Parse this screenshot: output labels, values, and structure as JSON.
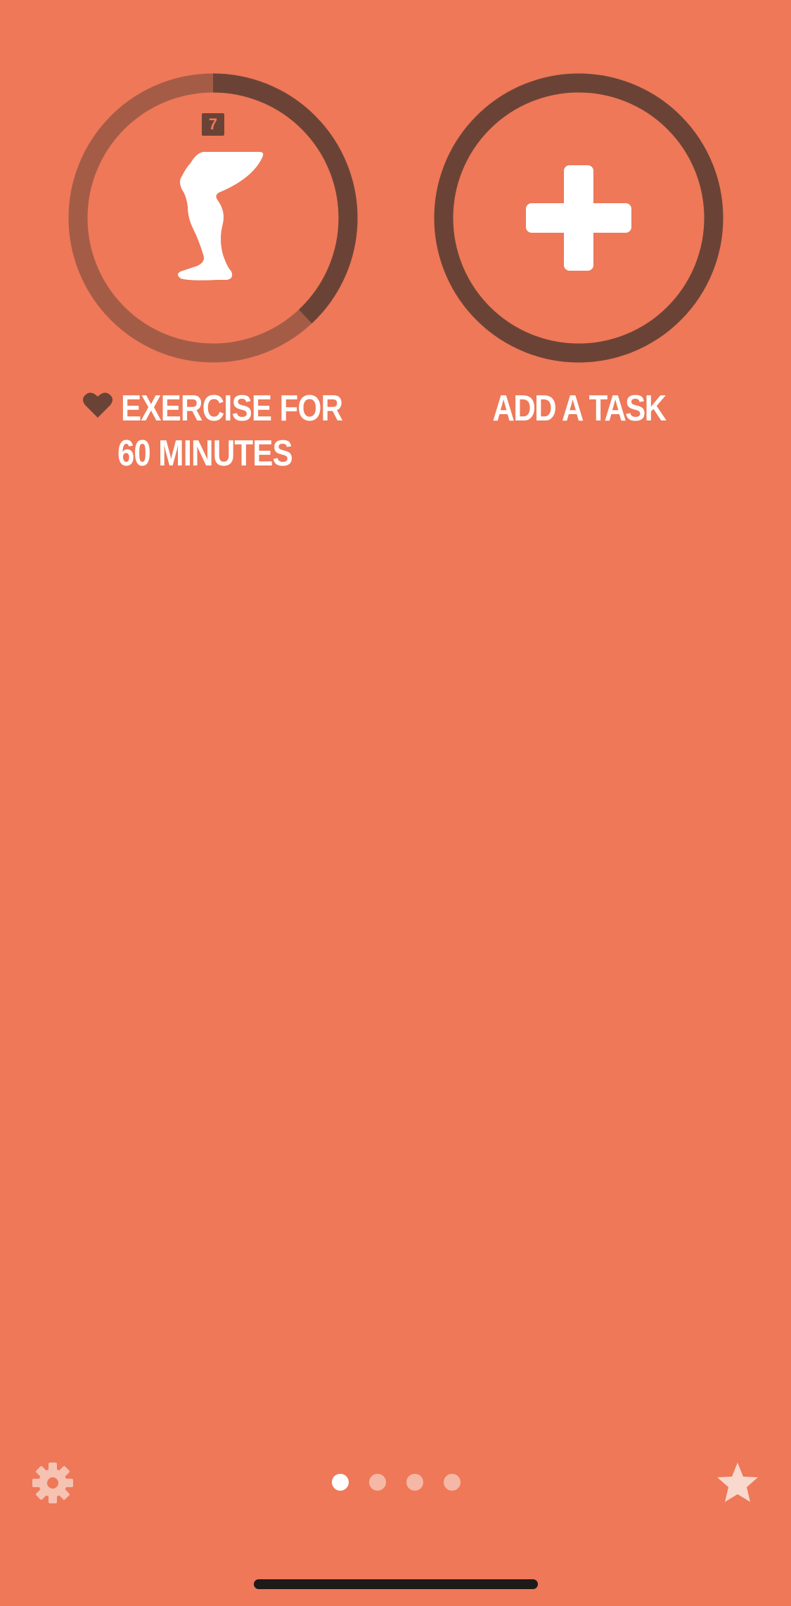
{
  "colors": {
    "background": "#EE7858",
    "ring_dark": "#6B4336",
    "ring_progress_light": "#A55C47",
    "text": "#FFFFFF",
    "dot_inactive": "#F6B8A6",
    "dot_active": "#FFFFFF",
    "star": "#F9D8CE",
    "gear": "#F6C2B2"
  },
  "tasks": [
    {
      "label_line1": "EXERCISE FOR",
      "label_line2": "60 MINUTES",
      "streak_badge": "7",
      "icon": "leg-icon",
      "favorite_icon": "heart-icon",
      "progress": 0.38
    },
    {
      "label_line1": "ADD A TASK",
      "icon": "plus-icon"
    }
  ],
  "footer": {
    "settings_icon": "gear-icon",
    "favorites_icon": "star-icon",
    "page_count": 4,
    "active_page": 1
  }
}
